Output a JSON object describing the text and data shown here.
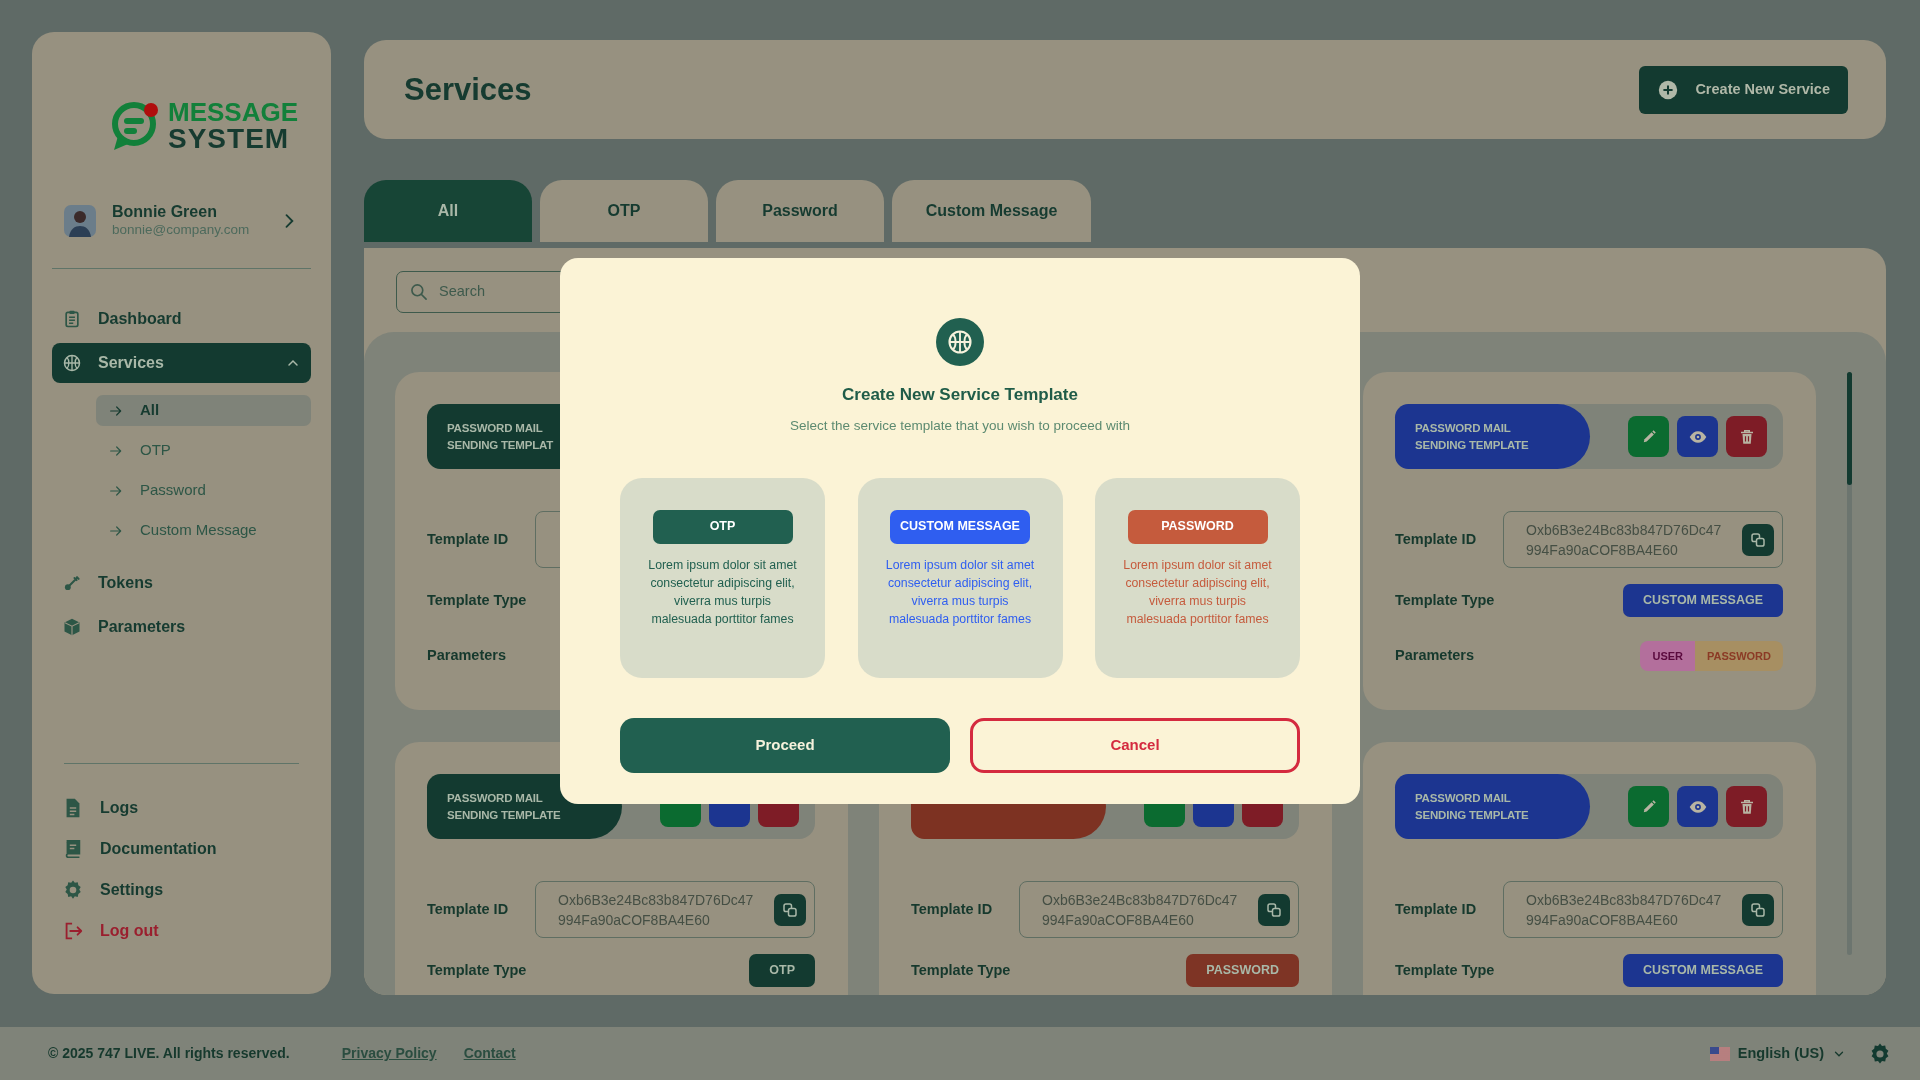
{
  "sidebar": {
    "logo": {
      "line_1": "MESSAGE",
      "line_2": "SYSTEM"
    },
    "user": {
      "name": "Bonnie Green",
      "email": "bonnie@company.com"
    },
    "nav": [
      {
        "label": "Dashboard",
        "selected": false
      },
      {
        "label": "Services",
        "selected": true,
        "expanded": true,
        "children": [
          {
            "label": "All",
            "selected": true
          },
          {
            "label": "OTP",
            "selected": false
          },
          {
            "label": "Password",
            "selected": false
          },
          {
            "label": "Custom Message",
            "selected": false
          }
        ]
      },
      {
        "label": "Tokens",
        "selected": false
      },
      {
        "label": "Parameters",
        "selected": false
      }
    ],
    "bottom_nav": [
      {
        "label": "Logs",
        "kind": "normal"
      },
      {
        "label": "Documentation",
        "kind": "normal"
      },
      {
        "label": "Settings",
        "kind": "normal"
      },
      {
        "label": "Log out",
        "kind": "danger"
      }
    ]
  },
  "header": {
    "title": "Services",
    "create_button": "Create New Service"
  },
  "tabs": [
    {
      "label": "All",
      "selected": true
    },
    {
      "label": "OTP",
      "selected": false
    },
    {
      "label": "Password",
      "selected": false
    },
    {
      "label": "Custom Message",
      "selected": false
    }
  ],
  "search": {
    "placeholder": "Search"
  },
  "cards": [
    {
      "kind": "otp",
      "title_lines": [
        "PASSWORD MAIL",
        "SENDING TEMPLAT"
      ],
      "show_actions": false,
      "id_label": "Template ID",
      "type_label": "Template Type",
      "params_label": "Parameters"
    },
    {
      "kind": "custom",
      "title_lines": [
        "PASSWORD MAIL",
        "SENDING TEMPLATE"
      ],
      "show_actions": true,
      "actions_covered": false,
      "id_label": "Template ID",
      "id_lines": [
        "Oxb6B3e24Bc83b847D76Dc47",
        "994Fa90aCOF8BA4E60"
      ],
      "type_label": "Template Type",
      "type_badge": "CUSTOM MESSAGE",
      "params_label": "Parameters",
      "parameters": [
        {
          "label": "USER",
          "kind": "user"
        },
        {
          "label": "PASSWORD",
          "kind": "password"
        }
      ]
    },
    {
      "kind": "otp",
      "title_lines": [
        "PASSWORD MAIL",
        "SENDING TEMPLATE"
      ],
      "show_actions": true,
      "actions_covered": true,
      "id_label": "Template ID",
      "id_lines": [
        "Oxb6B3e24Bc83b847D76Dc47",
        "994Fa90aCOF8BA4E60"
      ],
      "type_label": "Template Type",
      "type_badge": "OTP"
    },
    {
      "kind": "password",
      "show_actions": true,
      "actions_covered": true,
      "id_label": "Template ID",
      "id_lines": [
        "Oxb6B3e24Bc83b847D76Dc47",
        "994Fa90aCOF8BA4E60"
      ],
      "type_label": "Template Type",
      "type_badge": "PASSWORD"
    },
    {
      "kind": "custom",
      "title_lines": [
        "PASSWORD MAIL",
        "SENDING TEMPLATE"
      ],
      "show_actions": true,
      "actions_covered": false,
      "id_label": "Template ID",
      "id_lines": [
        "Oxb6B3e24Bc83b847D76Dc47",
        "994Fa90aCOF8BA4E60"
      ],
      "type_label": "Template Type",
      "type_badge": "CUSTOM MESSAGE"
    }
  ],
  "modal": {
    "title": "Create New Service Template",
    "subtitle": "Select the service template that you wish to proceed with",
    "options": [
      {
        "kind": "otp",
        "label": "OTP",
        "description": "Lorem ipsum dolor sit amet consectetur adipiscing elit, viverra mus turpis malesuada porttitor fames"
      },
      {
        "kind": "custom",
        "label": "CUSTOM MESSAGE",
        "description": "Lorem ipsum dolor sit amet consectetur adipiscing elit, viverra mus turpis malesuada porttitor fames"
      },
      {
        "kind": "password",
        "label": "PASSWORD",
        "description": "Lorem ipsum dolor sit amet consectetur adipiscing elit, viverra mus turpis malesuada porttitor fames"
      }
    ],
    "proceed": "Proceed",
    "cancel": "Cancel"
  },
  "footer": {
    "copyright": "© 2025 747 LIVE. All rights reserved.",
    "links": [
      "Privacy Policy",
      "Contact"
    ],
    "language": "English (US)"
  }
}
